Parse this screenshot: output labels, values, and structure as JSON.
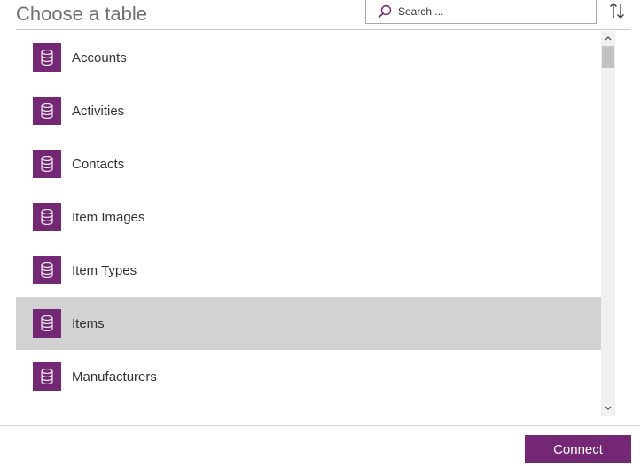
{
  "dialog": {
    "title": "Choose a table"
  },
  "search": {
    "placeholder": "Search ...",
    "value": ""
  },
  "icons": {
    "search": "search-icon",
    "sort": "sort-icon",
    "table": "database-icon",
    "scroll_up": "chevron-up-icon",
    "scroll_down": "chevron-down-icon"
  },
  "colors": {
    "accent": "#742774",
    "selected_row": "#d2d2d2"
  },
  "tables": {
    "items": [
      {
        "label": "Accounts",
        "selected": false
      },
      {
        "label": "Activities",
        "selected": false
      },
      {
        "label": "Contacts",
        "selected": false
      },
      {
        "label": "Item Images",
        "selected": false
      },
      {
        "label": "Item Types",
        "selected": false
      },
      {
        "label": "Items",
        "selected": true
      },
      {
        "label": "Manufacturers",
        "selected": false
      }
    ]
  },
  "footer": {
    "connect_label": "Connect"
  }
}
